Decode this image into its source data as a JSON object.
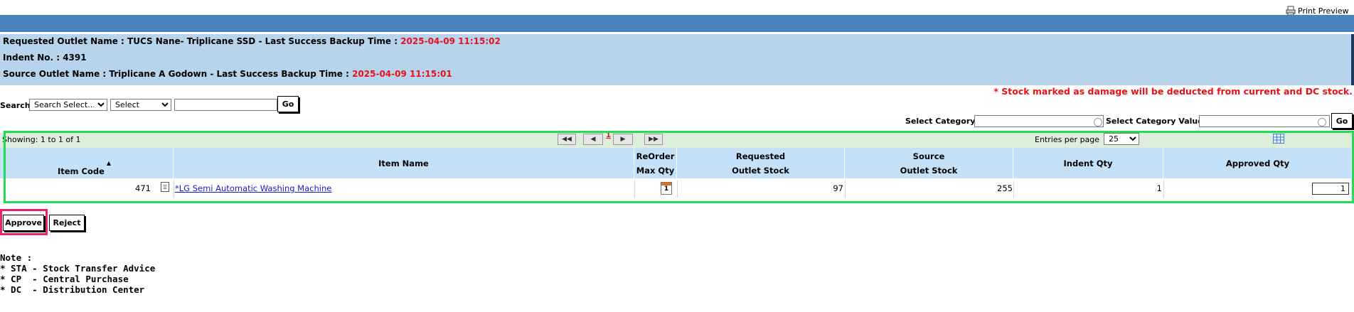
{
  "print_preview": "Print Preview",
  "info": {
    "requested_label": "Requested Outlet Name : TUCS Nane- Triplicane SSD - Last Success Backup Time :",
    "requested_time": "2025-04-09 11:15:02",
    "indent_label": "Indent No. : 4391",
    "source_label": "Source Outlet Name : Triplicane A Godown - Last Success Backup Time :",
    "source_time": "2025-04-09 11:15:01"
  },
  "damage_note": "* Stock marked as damage will be deducted from current and DC stock.",
  "search": {
    "label": "Search",
    "field_option": "Search Select...",
    "operator_option": "Select",
    "value": "",
    "go": "Go"
  },
  "category": {
    "label": "Select Category :",
    "value_label": "Select Category Value :",
    "go": "Go"
  },
  "paging": {
    "showing": "Showing: 1 to 1 of 1",
    "current_page": "1",
    "entries_label": "Entries per page",
    "entries_value": "25"
  },
  "table": {
    "headers": {
      "item_code": "Item Code",
      "item_name": "Item Name",
      "reorder_1": "ReOrder",
      "reorder_2": "Max Qty",
      "requested_1": "Requested",
      "requested_2": "Outlet Stock",
      "source_1": "Source",
      "source_2": "Outlet Stock",
      "indent_qty": "Indent Qty",
      "approved_qty": "Approved Qty"
    },
    "rows": [
      {
        "item_code": "471",
        "item_name": "*LG Semi Automatic Washing Machine",
        "reorder_icon_text": "1",
        "requested_stock": "97",
        "source_stock": "255",
        "indent_qty": "1",
        "approved_qty": "1"
      }
    ]
  },
  "actions": {
    "approve": "Approve",
    "reject": "Reject"
  },
  "notes": {
    "title": "Note :",
    "line1": "* STA - Stock Transfer Advice",
    "line2": "* CP  - Central Purchase",
    "line3": "* DC  - Distribution Center"
  }
}
